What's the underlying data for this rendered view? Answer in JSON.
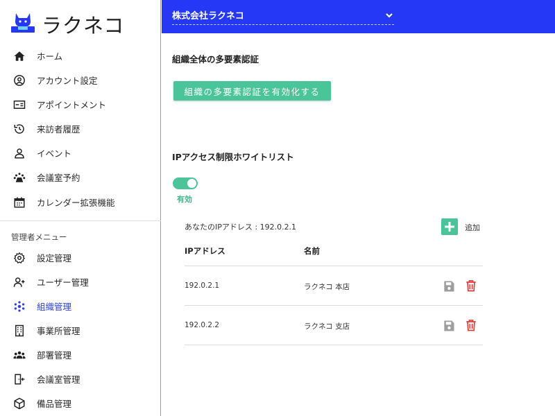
{
  "brand": {
    "name": "ラクネコ",
    "logo_icon": "cat-logo-icon"
  },
  "nav": [
    {
      "label": "ホーム",
      "icon": "home-icon"
    },
    {
      "label": "アカウント設定",
      "icon": "account-circle-icon"
    },
    {
      "label": "アポイントメント",
      "icon": "id-card-icon"
    },
    {
      "label": "来訪者履歴",
      "icon": "history-icon"
    },
    {
      "label": "イベント",
      "icon": "person-icon"
    },
    {
      "label": "会議室予約",
      "icon": "meeting-room-icon"
    },
    {
      "label": "カレンダー拡張機能",
      "icon": "calendar-icon"
    }
  ],
  "admin": {
    "title": "管理者メニュー",
    "items": [
      {
        "label": "設定管理",
        "icon": "gear-icon"
      },
      {
        "label": "ユーザー管理",
        "icon": "add-user-icon"
      },
      {
        "label": "組織管理",
        "icon": "organization-icon",
        "active": true
      },
      {
        "label": "事業所管理",
        "icon": "building-icon"
      },
      {
        "label": "部署管理",
        "icon": "group-icon"
      },
      {
        "label": "会議室管理",
        "icon": "door-enter-icon"
      },
      {
        "label": "備品管理",
        "icon": "box-icon"
      }
    ]
  },
  "header": {
    "org_name": "株式会社ラクネコ",
    "dropdown_icon": "chevron-down-icon"
  },
  "mfa": {
    "title": "組織全体の多要素認証",
    "button": "組織の多要素認証を有効化する"
  },
  "ip_whitelist": {
    "title": "IPアクセス制限ホワイトリスト",
    "enabled": true,
    "status_label": "有効",
    "your_ip": "あなたのIPアドレス : 192.0.2.1",
    "add_label": "追加",
    "columns": [
      "IPアドレス",
      "名前"
    ],
    "rows": [
      {
        "ip": "192.0.2.1",
        "name": "ラクネコ 本店"
      },
      {
        "ip": "192.0.2.2",
        "name": "ラクネコ 支店"
      }
    ]
  },
  "colors": {
    "header_bg": "#2438f5",
    "accent_green": "#4ac59a",
    "active_nav": "#2b3ff2",
    "delete_red": "#e53935",
    "save_gray": "#9e9e9e"
  }
}
